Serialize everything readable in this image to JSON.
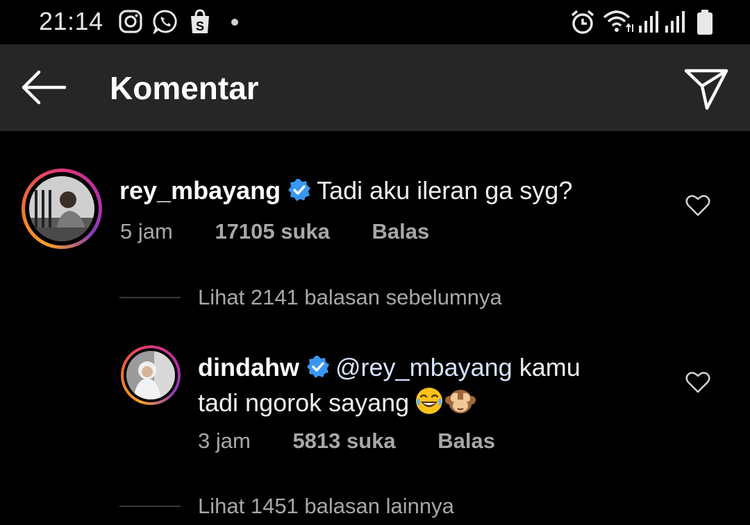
{
  "status_bar": {
    "time": "21:14",
    "left_icons": [
      "instagram-icon",
      "whatsapp-icon",
      "shopee-icon",
      "dot-icon"
    ],
    "right_icons": [
      "alarm-icon",
      "wifi-icon",
      "signal-icon",
      "signal-icon",
      "battery-icon"
    ]
  },
  "header": {
    "title": "Komentar",
    "back_icon": "arrow-left-icon",
    "share_icon": "send-icon"
  },
  "comments": [
    {
      "username": "rey_mbayang",
      "verified": true,
      "text": "Tadi aku ileran ga syg?",
      "time": "5 jam",
      "likes": "17105 suka",
      "reply_label": "Balas"
    }
  ],
  "view_replies_previous": "Lihat 2141 balasan sebelumnya",
  "reply": {
    "username": "dindahw",
    "verified": true,
    "mention": "@rey_mbayang",
    "text_line1_rest": "kamu",
    "text_line2": "tadi ngorok sayang",
    "emojis": [
      "laughing-emoji",
      "see-no-evil-monkey-emoji"
    ],
    "time": "3 jam",
    "likes": "5813 suka",
    "reply_label": "Balas"
  },
  "view_replies_more": "Lihat 1451 balasan lainnya",
  "colors": {
    "background": "#000000",
    "header_bg": "#262626",
    "text_primary": "#ffffff",
    "text_secondary": "#a8a8a8",
    "verified_blue": "#3897f0"
  }
}
